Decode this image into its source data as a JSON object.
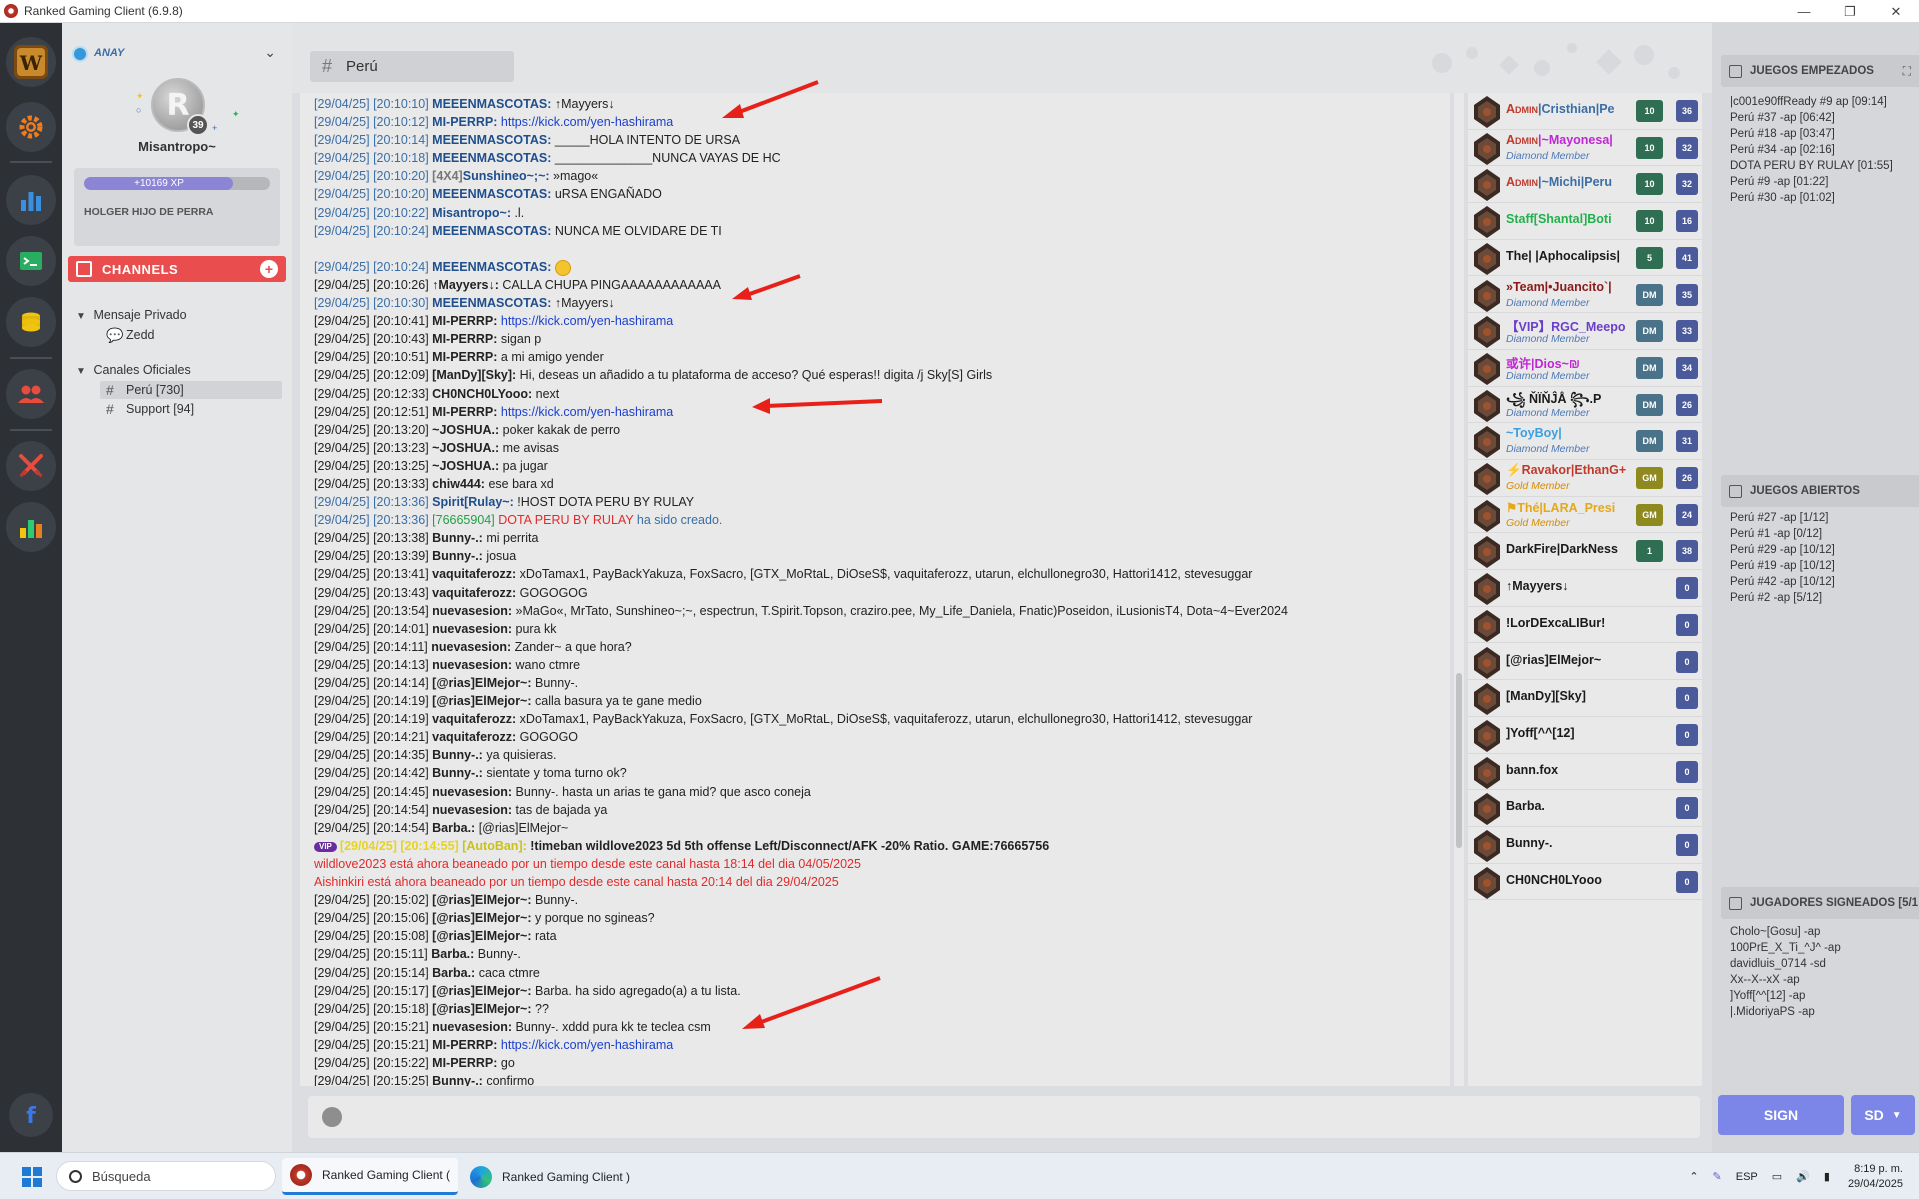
{
  "window": {
    "title": "Ranked Gaming Client (6.9.8)",
    "controls": [
      "—",
      "❐",
      "✕"
    ]
  },
  "profile": {
    "status_name": "ANAY",
    "level": "39",
    "display_name": "Misantropo~",
    "xp_label": "+10169 XP",
    "xp_progress": 0.8,
    "status_message": "HOLGER HIJO DE PERRA"
  },
  "channels_section": {
    "title": "CHANNELS",
    "add": "+"
  },
  "tree": {
    "private": {
      "label": "Mensaje Privado",
      "items": [
        {
          "label": "Zedd"
        }
      ]
    },
    "official": {
      "label": "Canales Oficiales",
      "items": [
        {
          "label": "Perú [730]"
        },
        {
          "label": "Support [94]"
        }
      ]
    }
  },
  "chat": {
    "channel_name": "Perú",
    "hash": "#",
    "lines": [
      {
        "ts": "[29/04/25] [20:10:10]",
        "nick": "MEEENMASCOTAS:",
        "msg": "↑Mayyers↓",
        "style": "sys"
      },
      {
        "ts": "[29/04/25] [20:10:12]",
        "nick": "MI-PERRP:",
        "link": "https://kick.com/yen-hashirama",
        "style": "sys"
      },
      {
        "ts": "[29/04/25] [20:10:14]",
        "nick": "MEEENMASCOTAS:",
        "msg": "_____HOLA INTENTO DE URSA",
        "style": "sys"
      },
      {
        "ts": "[29/04/25] [20:10:18]",
        "nick": "MEEENMASCOTAS:",
        "msg": "______________NUNCA VAYAS DE HC",
        "style": "sys"
      },
      {
        "ts": "[29/04/25] [20:10:20]",
        "nick": "[4X4]Sunshineo~;~:",
        "msg": "»mago«",
        "style": "sys"
      },
      {
        "ts": "[29/04/25] [20:10:20]",
        "nick": "MEEENMASCOTAS:",
        "msg": "uRSA ENGAÑADO",
        "style": "sys"
      },
      {
        "ts": "[29/04/25] [20:10:22]",
        "nick": "Misantropo~:",
        "msg": ".l.",
        "style": "sys"
      },
      {
        "ts": "[29/04/25] [20:10:24]",
        "nick": "MEEENMASCOTAS:",
        "msg": "NUNCA ME OLVIDARE DE TI",
        "style": "sys"
      },
      {
        "ts": "",
        "nick": "",
        "msg": "",
        "style": "blank"
      },
      {
        "ts": "[29/04/25] [20:10:24]",
        "nick": "MEEENMASCOTAS:",
        "msg": "",
        "emoji": true,
        "style": "sys"
      },
      {
        "ts": "[29/04/25] [20:10:26]",
        "nick": "↑Mayyers↓:",
        "msg": "CALLA CHUPA PINGAAAAAAAAAAAA",
        "style": "plain"
      },
      {
        "ts": "[29/04/25] [20:10:30]",
        "nick": "MEEENMASCOTAS:",
        "msg": "↑Mayyers↓",
        "style": "sys"
      },
      {
        "ts": "[29/04/25] [20:10:41]",
        "nick": "MI-PERRP:",
        "link": "https://kick.com/yen-hashirama",
        "style": "plain"
      },
      {
        "ts": "[29/04/25] [20:10:43]",
        "nick": "MI-PERRP:",
        "msg": "sigan p",
        "style": "plain"
      },
      {
        "ts": "[29/04/25] [20:10:51]",
        "nick": "MI-PERRP:",
        "msg": "a mi amigo yender",
        "style": "plain"
      },
      {
        "ts": "[29/04/25] [20:12:09]",
        "nick": "[ManDy][Sky]:",
        "msg": "Hi, deseas un añadido a tu plataforma de acceso? Qué esperas!! digita /j Sky[S] Girls",
        "style": "plain"
      },
      {
        "ts": "[29/04/25] [20:12:33]",
        "nick": "CH0NCH0LYooo:",
        "msg": "next",
        "style": "plain"
      },
      {
        "ts": "[29/04/25] [20:12:51]",
        "nick": "MI-PERRP:",
        "link": "https://kick.com/yen-hashirama",
        "style": "plain"
      },
      {
        "ts": "[29/04/25] [20:13:20]",
        "nick": "~JOSHUA.:",
        "msg": "poker kakak de perro",
        "style": "plain"
      },
      {
        "ts": "[29/04/25] [20:13:23]",
        "nick": "~JOSHUA.:",
        "msg": "me avisas",
        "style": "plain"
      },
      {
        "ts": "[29/04/25] [20:13:25]",
        "nick": "~JOSHUA.:",
        "msg": "pa jugar",
        "style": "plain"
      },
      {
        "ts": "[29/04/25] [20:13:33]",
        "nick": "chiw444:",
        "msg": "ese bara xd",
        "style": "plain"
      },
      {
        "ts": "[29/04/25] [20:13:36]",
        "nick": "Spirit[Rulay~:",
        "msg": "!HOST DOTA PERU BY RULAY",
        "style": "sys"
      },
      {
        "ts": "[29/04/25] [20:13:36]",
        "game_id": "[76665904]",
        "game_name": "DOTA PERU BY RULAY",
        "msg": "ha sido creado.",
        "style": "created"
      },
      {
        "ts": "[29/04/25] [20:13:38]",
        "nick": "Bunny-.:",
        "msg": "mi perrita",
        "style": "plain"
      },
      {
        "ts": "[29/04/25] [20:13:39]",
        "nick": "Bunny-.:",
        "msg": "josua",
        "style": "plain"
      },
      {
        "ts": "[29/04/25] [20:13:41]",
        "nick": "vaquitaferozz:",
        "msg": "xDoTamax1, PayBackYakuza, FoxSacro, [GTX_MoRtaL, DiOseS$, vaquitaferozz, utarun, elchullonegro30, Hattori1412, stevesuggar",
        "style": "plain"
      },
      {
        "ts": "[29/04/25] [20:13:43]",
        "nick": "vaquitaferozz:",
        "msg": "GOGOGOG",
        "style": "plain"
      },
      {
        "ts": "[29/04/25] [20:13:54]",
        "nick": "nuevasesion:",
        "msg": "»MaGo«, MrTato, Sunshineo~;~, espectrun, T.Spirit.Topson, craziro.pee, My_Life_Daniela, Fnatic)Poseidon, iLusionisT4, Dota~4~Ever2024",
        "style": "plain"
      },
      {
        "ts": "[29/04/25] [20:14:01]",
        "nick": "nuevasesion:",
        "msg": "pura kk",
        "style": "plain"
      },
      {
        "ts": "[29/04/25] [20:14:11]",
        "nick": "nuevasesion:",
        "msg": "Zander~ a que hora?",
        "style": "plain"
      },
      {
        "ts": "[29/04/25] [20:14:13]",
        "nick": "nuevasesion:",
        "msg": "wano ctmre",
        "style": "plain"
      },
      {
        "ts": "[29/04/25] [20:14:14]",
        "nick": "[@rias]ElMejor~:",
        "msg": "Bunny-.",
        "style": "plain"
      },
      {
        "ts": "[29/04/25] [20:14:19]",
        "nick": "[@rias]ElMejor~:",
        "msg": "calla basura ya te gane medio",
        "style": "plain"
      },
      {
        "ts": "[29/04/25] [20:14:19]",
        "nick": "vaquitaferozz:",
        "msg": "xDoTamax1, PayBackYakuza, FoxSacro, [GTX_MoRtaL, DiOseS$, vaquitaferozz, utarun, elchullonegro30, Hattori1412, stevesuggar",
        "style": "plain"
      },
      {
        "ts": "[29/04/25] [20:14:21]",
        "nick": "vaquitaferozz:",
        "msg": "GOGOGO",
        "style": "plain"
      },
      {
        "ts": "[29/04/25] [20:14:35]",
        "nick": "Bunny-.:",
        "msg": "ya quisieras.",
        "style": "plain"
      },
      {
        "ts": "[29/04/25] [20:14:42]",
        "nick": "Bunny-.:",
        "msg": "sientate y toma turno ok?",
        "style": "plain"
      },
      {
        "ts": "[29/04/25] [20:14:45]",
        "nick": "nuevasesion:",
        "msg": "Bunny-. hasta un arias te gana mid? que asco coneja",
        "style": "plain"
      },
      {
        "ts": "[29/04/25] [20:14:54]",
        "nick": "nuevasesion:",
        "msg": "tas de bajada ya",
        "style": "plain"
      },
      {
        "ts": "[29/04/25] [20:14:54]",
        "nick": "Barba.:",
        "msg": "[@rias]ElMejor~",
        "style": "plain"
      },
      {
        "ts": "[29/04/25] [20:14:55]",
        "vip": "VIP",
        "nick": "[AutoBan]:",
        "msg": "!timeban wildlove2023 5d 5th offense Left/Disconnect/AFK -20% Ratio. GAME:76665756",
        "style": "autoban"
      },
      {
        "msg": "wildlove2023 está ahora beaneado por un tiempo desde este canal hasta 18:14 del dia 04/05/2025",
        "style": "ban"
      },
      {
        "msg": "Aishinkiri está ahora beaneado por un tiempo desde este canal hasta 20:14 del dia 29/04/2025",
        "style": "ban"
      },
      {
        "ts": "[29/04/25] [20:15:02]",
        "nick": "[@rias]ElMejor~:",
        "msg": "Bunny-.",
        "style": "plain"
      },
      {
        "ts": "[29/04/25] [20:15:06]",
        "nick": "[@rias]ElMejor~:",
        "msg": "y porque no sgineas?",
        "style": "plain"
      },
      {
        "ts": "[29/04/25] [20:15:08]",
        "nick": "[@rias]ElMejor~:",
        "msg": "rata",
        "style": "plain"
      },
      {
        "ts": "[29/04/25] [20:15:11]",
        "nick": "Barba.:",
        "msg": "Bunny-.",
        "style": "plain"
      },
      {
        "ts": "[29/04/25] [20:15:14]",
        "nick": "Barba.:",
        "msg": "caca ctmre",
        "style": "plain"
      },
      {
        "ts": "[29/04/25] [20:15:17]",
        "nick": "[@rias]ElMejor~:",
        "msg": "Barba. ha sido agregado(a) a tu lista.",
        "style": "plain"
      },
      {
        "ts": "[29/04/25] [20:15:18]",
        "nick": "[@rias]ElMejor~:",
        "msg": "??",
        "style": "plain"
      },
      {
        "ts": "[29/04/25] [20:15:21]",
        "nick": "nuevasesion:",
        "msg": "Bunny-. xddd pura kk te teclea csm",
        "style": "plain"
      },
      {
        "ts": "[29/04/25] [20:15:21]",
        "nick": "MI-PERRP:",
        "link": "https://kick.com/yen-hashirama",
        "style": "plain"
      },
      {
        "ts": "[29/04/25] [20:15:22]",
        "nick": "MI-PERRP:",
        "msg": "go",
        "style": "plain"
      },
      {
        "ts": "[29/04/25] [20:15:25]",
        "nick": "Bunny-.:",
        "msg": "confirmo",
        "style": "plain"
      },
      {
        "ts": "[29/04/25] [20:15:32]",
        "nick": "nuevasesion:",
        "msg": "barba arias",
        "style": "plain"
      }
    ],
    "input_placeholder": ""
  },
  "users": [
    {
      "rank": "Admin",
      "name": "|Cristhian|Pe",
      "name_color": "#3a6ea5",
      "sub": "",
      "b1": "10",
      "b1c": "green",
      "b2": "36"
    },
    {
      "rank": "Admin",
      "name": "|~Mayonesa|",
      "name_color": "#c026d3",
      "sub": "Diamond Member",
      "b1": "10",
      "b1c": "green",
      "b2": "32"
    },
    {
      "rank": "Admin",
      "name": "|~Michi|Peru",
      "name_color": "#3a6ea5",
      "sub": "",
      "b1": "10",
      "b1c": "green",
      "b2": "32"
    },
    {
      "rank": "",
      "name": "Staff[Shantal]Boti",
      "name_color": "#22b14c",
      "sub": "",
      "b1": "10",
      "b1c": "green",
      "b2": "16"
    },
    {
      "rank": "",
      "name": "The| |Aphocalipsis|",
      "name_color": "#1a1a1a",
      "sub": "",
      "b1": "5",
      "b1c": "green",
      "b2": "41"
    },
    {
      "rank": "",
      "name": "»Team|•Juancito`|",
      "name_color": "#8b1a1a",
      "sub": "Diamond Member",
      "b1": "DM",
      "b1c": "steel",
      "b2": "35"
    },
    {
      "rank": "",
      "name": "【VIP】RGC_Meepo",
      "name_color": "#6a3fc7",
      "sub": "Diamond Member",
      "b1": "DM",
      "b1c": "steel",
      "b2": "33"
    },
    {
      "rank": "",
      "name": "或许|Dios~₪",
      "name_color": "#c026d3",
      "sub": "Diamond Member",
      "b1": "DM",
      "b1c": "steel",
      "b2": "34"
    },
    {
      "rank": "",
      "name": "꧁ ŇÏŇĴÅ ꧂.P",
      "name_color": "#1a1a1a",
      "sub": "Diamond Member",
      "b1": "DM",
      "b1c": "steel",
      "b2": "26"
    },
    {
      "rank": "",
      "name": "~ToyBoy|",
      "name_color": "#3ba0e0",
      "sub": "Diamond Member",
      "b1": "DM",
      "b1c": "steel",
      "b2": "31"
    },
    {
      "rank": "",
      "name": "⚡Ravakor|EthanG+",
      "name_color": "#c0392b",
      "sub": "Gold Member",
      "b1": "GM",
      "b1c": "gold",
      "b2": "26"
    },
    {
      "rank": "",
      "name": "⚑Thé|LARA_Presi",
      "name_color": "#e6a817",
      "sub": "Gold Member",
      "b1": "GM",
      "b1c": "gold",
      "b2": "24"
    },
    {
      "rank": "",
      "name": "DarkFire|DarkNess",
      "name_color": "#1a1a1a",
      "sub": "",
      "b1": "1",
      "b1c": "green",
      "b2": "38"
    },
    {
      "rank": "",
      "name": "↑Mayyers↓",
      "name_color": "#1a1a1a",
      "sub": "",
      "b1": "",
      "b1c": "",
      "b2": "0"
    },
    {
      "rank": "",
      "name": "!LorDExcaLIBur!",
      "name_color": "#1a1a1a",
      "sub": "",
      "b1": "",
      "b1c": "",
      "b2": "0"
    },
    {
      "rank": "",
      "name": "[@rias]ElMejor~",
      "name_color": "#1a1a1a",
      "sub": "",
      "b1": "",
      "b1c": "",
      "b2": "0"
    },
    {
      "rank": "",
      "name": "[ManDy][Sky]",
      "name_color": "#1a1a1a",
      "sub": "",
      "b1": "",
      "b1c": "",
      "b2": "0"
    },
    {
      "rank": "",
      "name": "]Yoff[^^[12]",
      "name_color": "#1a1a1a",
      "sub": "",
      "b1": "",
      "b1c": "",
      "b2": "0"
    },
    {
      "rank": "",
      "name": "bann.fox",
      "name_color": "#1a1a1a",
      "sub": "",
      "b1": "",
      "b1c": "",
      "b2": "0"
    },
    {
      "rank": "",
      "name": "Barba.",
      "name_color": "#1a1a1a",
      "sub": "",
      "b1": "",
      "b1c": "",
      "b2": "0"
    },
    {
      "rank": "",
      "name": "Bunny-.",
      "name_color": "#1a1a1a",
      "sub": "",
      "b1": "",
      "b1c": "",
      "b2": "0"
    },
    {
      "rank": "",
      "name": "CH0NCH0LYooo",
      "name_color": "#1a1a1a",
      "sub": "",
      "b1": "",
      "b1c": "",
      "b2": "0"
    }
  ],
  "right_panel": {
    "started": {
      "title": "JUEGOS EMPEZADOS",
      "items": [
        "|c001e90ffReady #9 ap [09:14]",
        "Perú  #37 -ap [06:42]",
        "Perú  #18 -ap [03:47]",
        "Perú  #34 -ap [02:16]",
        "DOTA PERU BY RULAY [01:55]",
        "Perú  #9 -ap [01:22]",
        "Perú  #30 -ap [01:02]"
      ]
    },
    "open": {
      "title": "JUEGOS ABIERTOS",
      "items": [
        "Perú  #27 -ap [1/12]",
        "Perú  #1 -ap [0/12]",
        "Perú  #29 -ap [10/12]",
        "Perú  #19 -ap [10/12]",
        "Perú  #42 -ap [10/12]",
        "Perú  #2 -ap [5/12]"
      ]
    },
    "signed": {
      "title": "JUGADORES SIGNEADOS [5/1",
      "items": [
        "Cholo~[Gosu] -ap",
        "100PrE_X_Ti_^J^ -ap",
        "davidluis_0714 -sd",
        "Xx--X--xX -ap",
        "]Yoff[^^[12] -ap",
        "|.MidoriyaPS -ap"
      ]
    }
  },
  "actions": {
    "sign": "SIGN",
    "sd": "SD"
  },
  "taskbar": {
    "search_placeholder": "Búsqueda",
    "apps": [
      "Ranked Gaming Client (",
      "Ranked Gaming Client )"
    ],
    "lang": "ESP",
    "time": "8:19 p. m.",
    "date": "29/04/2025"
  },
  "colors": {
    "accent": "#ea4d4d",
    "sign": "#7c86e8",
    "link": "#1a3fcf",
    "ban": "#e22a2a"
  }
}
